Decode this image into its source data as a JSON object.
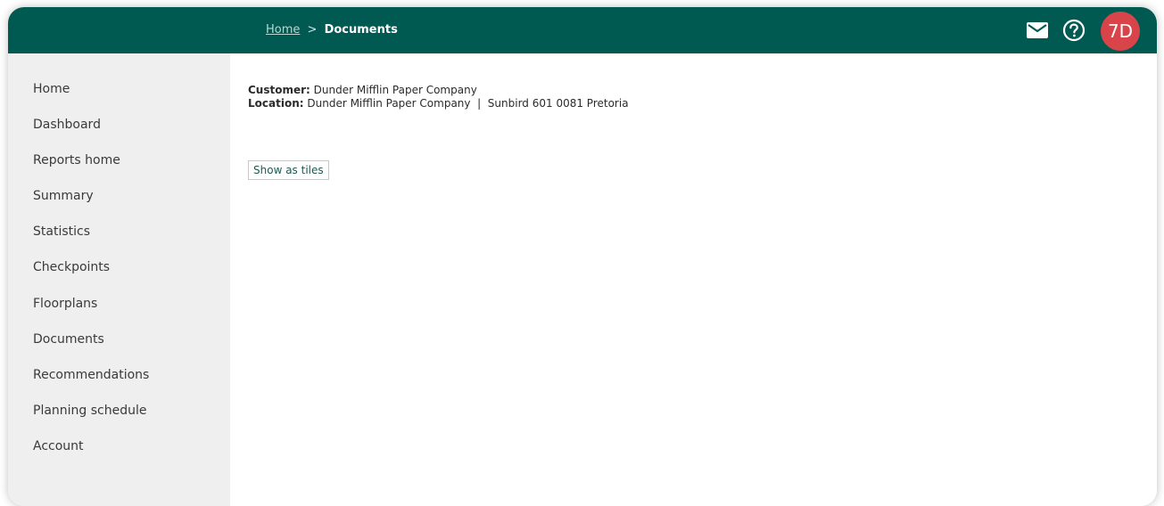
{
  "header": {
    "breadcrumb": {
      "home": "Home",
      "separator": ">",
      "current": "Documents"
    },
    "icons": {
      "mail": "mail-icon",
      "help": "help-icon"
    },
    "avatar_initials": "7D",
    "colors": {
      "bar": "#005a52",
      "avatar": "#d8444a"
    }
  },
  "sidebar": {
    "items": [
      {
        "label": "Home"
      },
      {
        "label": "Dashboard"
      },
      {
        "label": "Reports home"
      },
      {
        "label": "Summary"
      },
      {
        "label": "Statistics"
      },
      {
        "label": "Checkpoints"
      },
      {
        "label": "Floorplans"
      },
      {
        "label": "Documents"
      },
      {
        "label": "Recommendations"
      },
      {
        "label": "Planning schedule"
      },
      {
        "label": "Account"
      }
    ]
  },
  "main": {
    "customer_label": "Customer:",
    "customer_value": "Dunder Mifflin Paper Company",
    "location_label": "Location:",
    "location_value": "Dunder Mifflin Paper Company  |  Sunbird 601 0081 Pretoria",
    "view_toggle_label": "Show as tiles"
  }
}
